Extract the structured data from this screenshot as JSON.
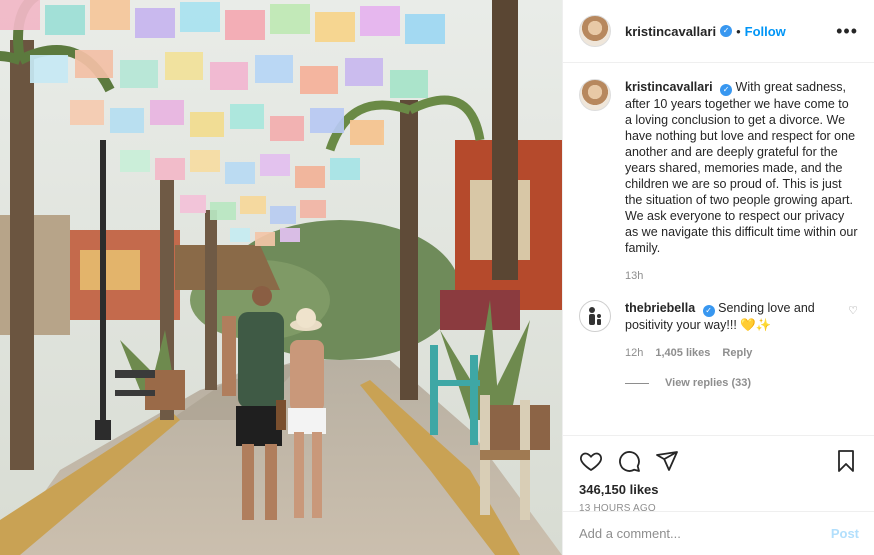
{
  "post": {
    "username": "kristincavallari",
    "verified_icon": "verified-badge-icon",
    "follow_label": "Follow",
    "separator": "•",
    "more_label": "•••"
  },
  "caption": {
    "username": "kristincavallari",
    "text": "With great sadness, after 10 years together we have come to a loving conclusion to get a divorce. We have nothing but love and respect for one another and are deeply grateful for the years shared, memories made, and the children we are so proud of. This is just the situation of two people growing apart. We ask everyone to respect our privacy as we navigate this difficult time within our family.",
    "age": "13h"
  },
  "comment": {
    "username": "thebriebella",
    "text": "Sending love and positivity your way!!! 💛✨",
    "age": "12h",
    "likes": "1,405 likes",
    "reply_label": "Reply",
    "view_replies": "View replies (33)"
  },
  "actions": {
    "likes_count": "346,150 likes",
    "timestamp": "13 HOURS AGO"
  },
  "add_comment": {
    "placeholder": "Add a comment...",
    "post_label": "Post",
    "post_color": "#b2dffc"
  },
  "colors": {
    "accent": "#0095f6",
    "verified": "#3897f0",
    "muted": "#8e8e8e"
  }
}
